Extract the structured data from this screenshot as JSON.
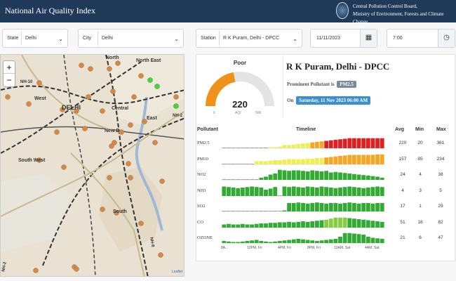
{
  "header": {
    "title": "National Air Quality Index",
    "org_line1": "Central Pollution Control Board,",
    "org_line2": "Ministry of Environment, Forests and Climate Change"
  },
  "filters": {
    "state_label": "State",
    "state_value": "Delhi",
    "city_label": "City",
    "city_value": "Delhi",
    "station_label": "Station",
    "station_value": "R K Puram, Delhi - DPCC",
    "date_value": "11/11/2023",
    "time_value": "7:00"
  },
  "map": {
    "labels": [
      "North",
      "North East",
      "NH-10",
      "West",
      "DELHI",
      "Central",
      "New D",
      "NH-2",
      "East",
      "South West",
      "South",
      "NH-8",
      "NH-2"
    ],
    "zoom_in": "+",
    "zoom_out": "−",
    "attribution": "Leaflet"
  },
  "station": {
    "name": "R K Puram, Delhi - DPCC",
    "category": "Poor",
    "aqi": "220",
    "aqi_fraction": 0.44,
    "scale_min": "0",
    "scale_mid": "AQI",
    "scale_max": "500",
    "prominent_label": "Prominent Pollutant is",
    "prominent": "PM2.5",
    "on_label": "On",
    "datetime": "Saturday, 11 Nov 2023 06:00 AM"
  },
  "table": {
    "headers": {
      "pollutant": "Pollutant",
      "timeline": "Timeline",
      "avg": "Avg",
      "min": "Min",
      "max": "Max"
    },
    "rows": [
      {
        "name": "PM2.5",
        "avg": "220",
        "min": "20",
        "max": "361",
        "levels": [
          0.05,
          0.05,
          0.05,
          0.05,
          0.05,
          0.05,
          0.05,
          0.05,
          0.05,
          0.05,
          0.1,
          0.1,
          0.15,
          0.3,
          0.3,
          0.35,
          0.4,
          0.45,
          0.5,
          0.55,
          0.6,
          0.65,
          0.7,
          0.75,
          0.8,
          0.85,
          0.9,
          0.95,
          0.95,
          0.95,
          0.95,
          0.95,
          0.95,
          0.95,
          0.95
        ],
        "colors": [
          "#8a8",
          "#8a8",
          "#8a8",
          "#8a8",
          "#8a8",
          "#8a8",
          "#8a8",
          "#8a8",
          "#8a8",
          "#8a8",
          "#ee5",
          "#ee5",
          "#ee5",
          "#ee5",
          "#ee5",
          "#ee5",
          "#ee5",
          "#ee5",
          "#ee5",
          "#f5a623",
          "#f5a623",
          "#f5a623",
          "#e02020",
          "#e02020",
          "#e02020",
          "#e02020",
          "#e02020",
          "#e02020",
          "#e02020",
          "#e02020",
          "#e02020",
          "#e02020",
          "#e02020",
          "#e02020",
          "#e02020"
        ]
      },
      {
        "name": "PM10",
        "avg": "157",
        "min": "85",
        "max": "234",
        "levels": [
          0.05,
          0.05,
          0.05,
          0.05,
          0.05,
          0.05,
          0.05,
          0.3,
          0.3,
          0.3,
          0.35,
          0.4,
          0.4,
          0.45,
          0.5,
          0.5,
          0.5,
          0.5,
          0.55,
          0.55,
          0.6,
          0.6,
          0.65,
          0.7,
          0.75,
          0.8,
          0.85,
          0.9,
          0.9,
          0.9,
          0.9,
          0.9,
          0.9,
          0.95,
          0.95
        ],
        "colors": [
          "#8a8",
          "#8a8",
          "#8a8",
          "#8a8",
          "#8a8",
          "#8a8",
          "#8a8",
          "#ee5",
          "#ee5",
          "#ee5",
          "#ee5",
          "#ee5",
          "#ee5",
          "#ee5",
          "#ee5",
          "#ee5",
          "#ee5",
          "#ee5",
          "#ee5",
          "#ee5",
          "#ee5",
          "#ee5",
          "#f5a623",
          "#f5a623",
          "#f5a623",
          "#f5a623",
          "#f5a623",
          "#f5a623",
          "#f5a623",
          "#f5a623",
          "#f5a623",
          "#f5a623",
          "#f5a623",
          "#f5a623",
          "#f5a623"
        ]
      },
      {
        "name": "NO2",
        "avg": "24",
        "min": "4",
        "max": "38",
        "levels": [
          0.05,
          0.05,
          0.05,
          0.05,
          0.05,
          0.05,
          0.05,
          0.05,
          0.2,
          0.3,
          0.5,
          0.6,
          0.95,
          0.9,
          0.85,
          0.9,
          0.9,
          0.85,
          0.8,
          0.9,
          0.85,
          0.8,
          0.85,
          0.7,
          0.75,
          0.7,
          0.65,
          0.6,
          0.55,
          0.5,
          0.45,
          0.4,
          0.35,
          0.3,
          0.2
        ],
        "colors": [
          "#3a3"
        ]
      },
      {
        "name": "NH3",
        "avg": "4",
        "min": "3",
        "max": "5",
        "levels": [
          0.9,
          0.85,
          0.8,
          0.75,
          0.8,
          0.85,
          0.9,
          0.85,
          0.8,
          0.6,
          0.7,
          0.85,
          0.05,
          0.9,
          0.85,
          0.9,
          0.85,
          0.8,
          0.9,
          0.85,
          0.8,
          0.9,
          0.85,
          0.8,
          0.75,
          0.8,
          0.85,
          0.9,
          0.85,
          0.8,
          0.75,
          0.8,
          0.85,
          0.9,
          0.85
        ],
        "colors": [
          "#3a3"
        ]
      },
      {
        "name": "SO2",
        "avg": "17",
        "min": "1",
        "max": "29",
        "levels": [
          0.05,
          0.05,
          0.05,
          0.05,
          0.05,
          0.05,
          0.05,
          0.05,
          0.05,
          0.05,
          0.05,
          0.05,
          0.05,
          0.1,
          0.8,
          0.8,
          0.85,
          0.8,
          0.75,
          0.8,
          0.85,
          0.8,
          0.75,
          0.8,
          0.8,
          0.75,
          0.8,
          0.85,
          0.8,
          0.75,
          0.8,
          0.8,
          0.75,
          0.8,
          0.8
        ],
        "colors": [
          "#3a3"
        ]
      },
      {
        "name": "CO",
        "avg": "51",
        "min": "18",
        "max": "82",
        "levels": [
          0.3,
          0.35,
          0.3,
          0.3,
          0.35,
          0.3,
          0.3,
          0.35,
          0.4,
          0.4,
          0.45,
          0.45,
          0.5,
          0.5,
          0.55,
          0.5,
          0.55,
          0.6,
          0.55,
          0.6,
          0.65,
          0.7,
          0.75,
          0.85,
          0.95,
          0.95,
          0.95,
          0.9,
          0.85,
          0.8,
          0.75,
          0.7,
          0.65,
          0.6,
          0.55
        ],
        "colors": [
          "#3a3",
          "#3a3",
          "#3a3",
          "#3a3",
          "#3a3",
          "#3a3",
          "#3a3",
          "#3a3",
          "#3a3",
          "#3a3",
          "#3a3",
          "#3a3",
          "#3a3",
          "#3a3",
          "#3a3",
          "#3a3",
          "#3a3",
          "#3a3",
          "#3a3",
          "#3a3",
          "#3a3",
          "#3a3",
          "#8c4",
          "#8c4",
          "#8c4",
          "#8c4",
          "#8c4",
          "#3a3",
          "#3a3",
          "#3a3",
          "#3a3",
          "#3a3",
          "#3a3",
          "#3a3",
          "#3a3"
        ]
      },
      {
        "name": "OZONE",
        "avg": "21",
        "min": "6",
        "max": "47",
        "levels": [
          0.2,
          0.15,
          0.1,
          0.1,
          0.15,
          0.2,
          0.25,
          0.3,
          0.2,
          0.15,
          0.1,
          0.15,
          0.2,
          0.25,
          0.3,
          0.35,
          0.4,
          0.35,
          0.3,
          0.25,
          0.2,
          0.25,
          0.3,
          0.35,
          0.4,
          0.6,
          0.95,
          0.95,
          0.9,
          0.85,
          0.8,
          0.6,
          0.5,
          0.45,
          0.4
        ],
        "colors": [
          "#3a3"
        ]
      }
    ],
    "time_labels": [
      "8A...",
      "12PM, Fri",
      "4PM, Fri",
      "8PM, Fri",
      "12AM, Sat",
      "4AM, Sat"
    ]
  }
}
